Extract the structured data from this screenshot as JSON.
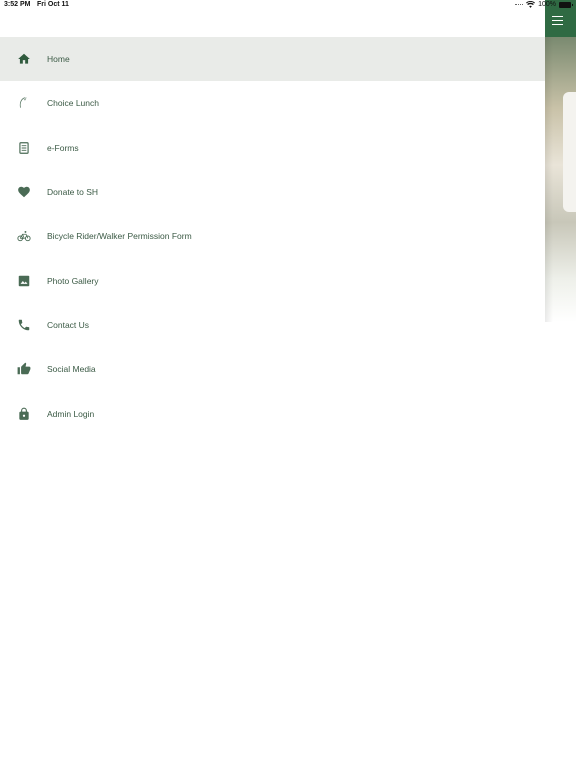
{
  "status_bar": {
    "time": "3:52 PM",
    "date": "Fri Oct 11",
    "battery": "100%"
  },
  "colors": {
    "brand_green": "#2f6a43",
    "icon_green": "#4a6b55",
    "active_bg": "#e9ebe8"
  },
  "menu": {
    "items": [
      {
        "label": "Home",
        "icon": "home-icon",
        "active": true
      },
      {
        "label": "Choice Lunch",
        "icon": "choice-lunch-icon",
        "active": false
      },
      {
        "label": "e-Forms",
        "icon": "document-icon",
        "active": false
      },
      {
        "label": "Donate to SH",
        "icon": "heart-icon",
        "active": false
      },
      {
        "label": "Bicycle Rider/Walker Permission Form",
        "icon": "bicycle-icon",
        "active": false
      },
      {
        "label": "Photo Gallery",
        "icon": "image-icon",
        "active": false
      },
      {
        "label": "Contact Us",
        "icon": "phone-icon",
        "active": false
      },
      {
        "label": "Social Media",
        "icon": "thumbs-up-icon",
        "active": false
      },
      {
        "label": "Admin Login",
        "icon": "lock-icon",
        "active": false
      }
    ]
  }
}
